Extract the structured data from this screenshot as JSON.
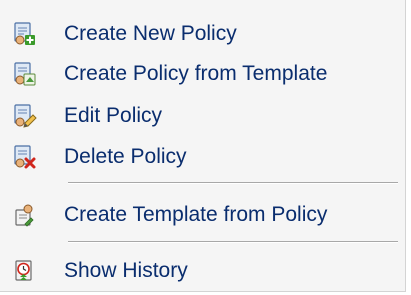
{
  "menu": {
    "items": [
      {
        "label": "Create New Policy",
        "icon": "policy-add-icon"
      },
      {
        "label": "Create Policy from Template",
        "icon": "policy-from-template-icon"
      },
      {
        "label": "Edit Policy",
        "icon": "policy-edit-icon"
      },
      {
        "label": "Delete Policy",
        "icon": "policy-delete-icon"
      },
      {
        "label": "Create Template from Policy",
        "icon": "template-from-policy-icon"
      },
      {
        "label": "Show History",
        "icon": "history-icon"
      }
    ]
  },
  "colors": {
    "menu_background": "#f5f5f5",
    "label_text": "#0a2d6e",
    "separator": "#a8a8a8"
  }
}
